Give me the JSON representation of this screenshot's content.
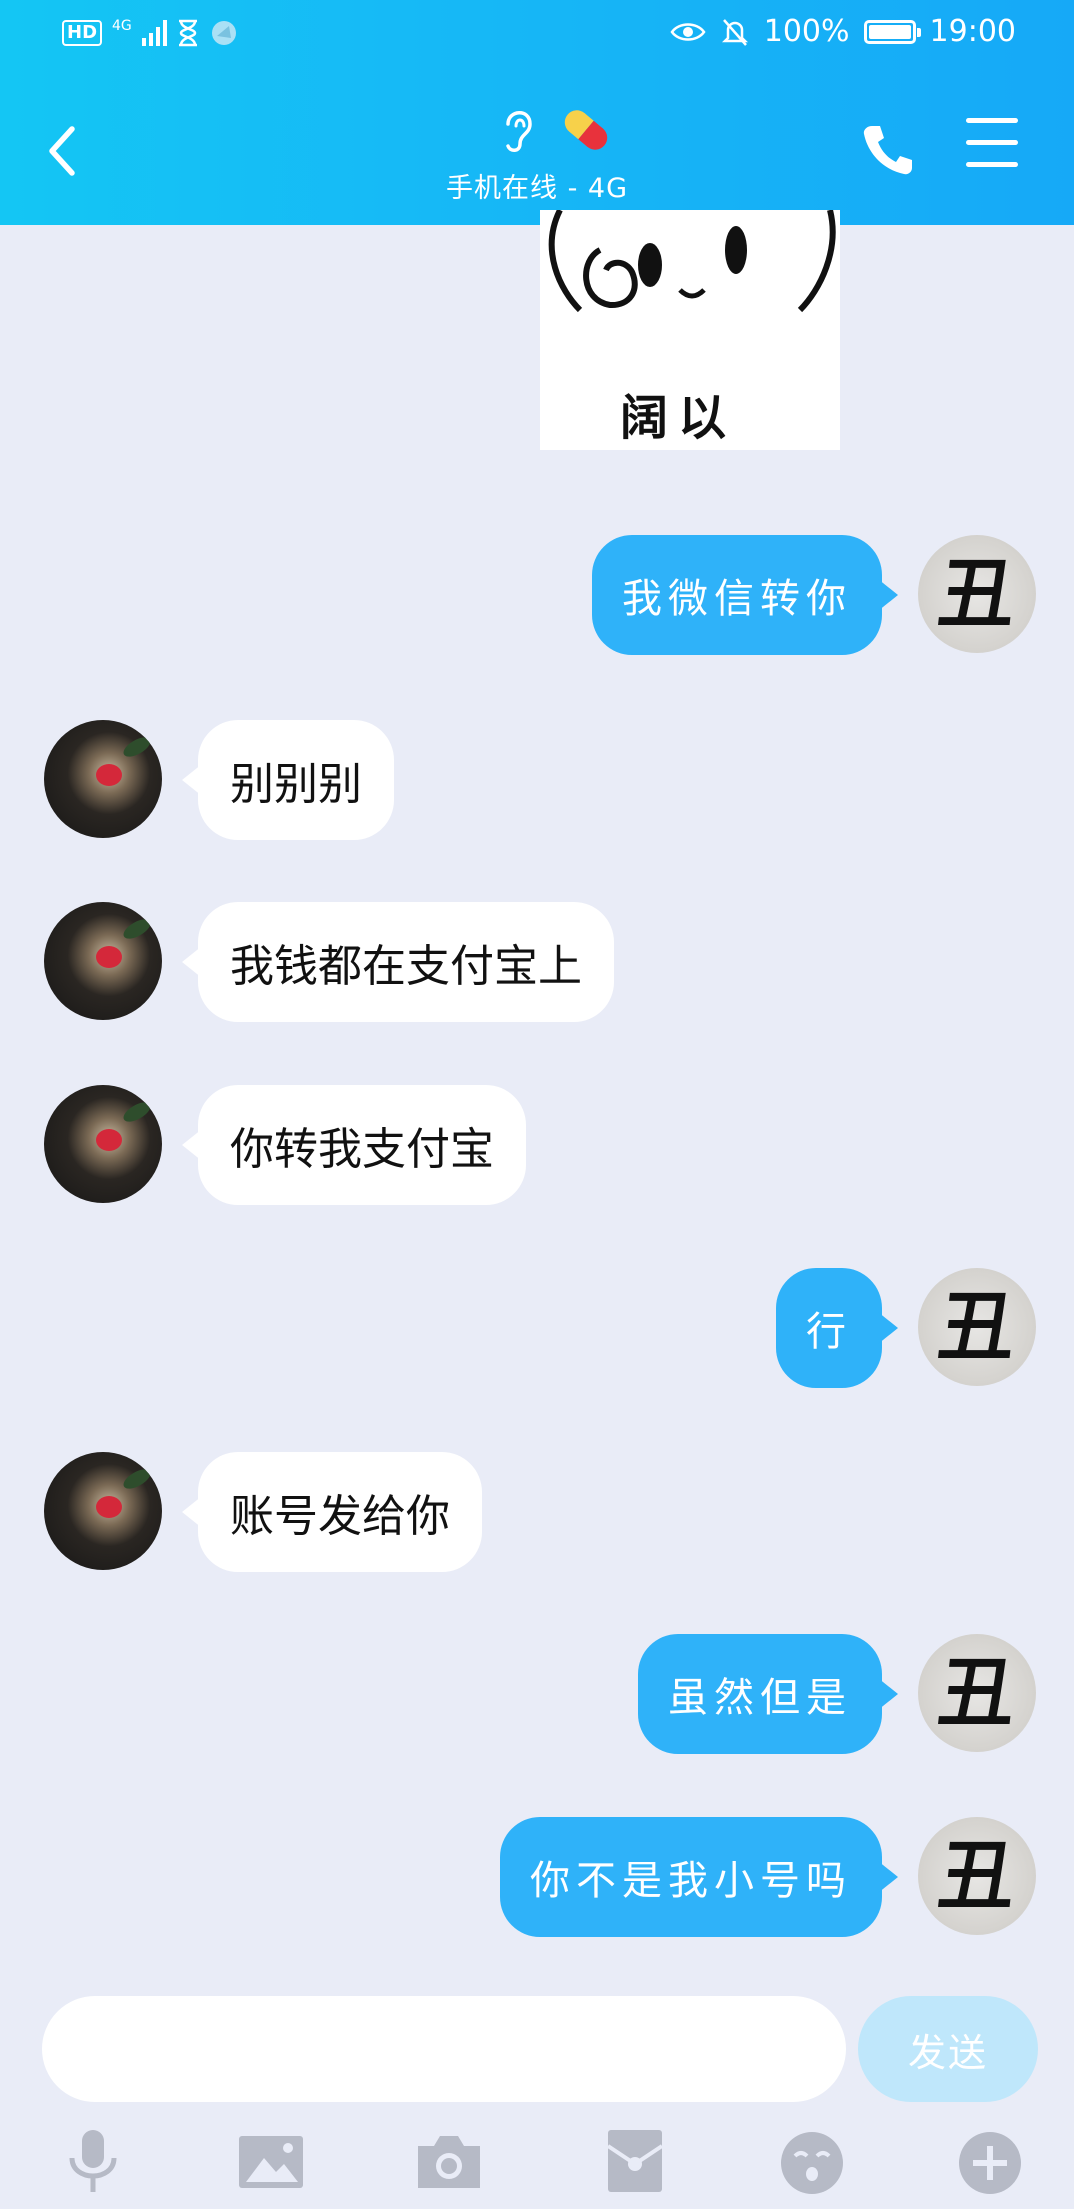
{
  "status_bar": {
    "network": "4G",
    "hd": "HD",
    "battery": "100%",
    "time": "19:00"
  },
  "header": {
    "subtitle": "手机在线 - 4G"
  },
  "sticker": {
    "caption": "阔以"
  },
  "messages": [
    {
      "from": "me",
      "text": "我微信转你"
    },
    {
      "from": "them",
      "text": "别别别"
    },
    {
      "from": "them",
      "text": "我钱都在支付宝上"
    },
    {
      "from": "them",
      "text": "你转我支付宝"
    },
    {
      "from": "me",
      "text": "行"
    },
    {
      "from": "them",
      "text": "账号发给你"
    },
    {
      "from": "me",
      "text": "虽然但是"
    },
    {
      "from": "me",
      "text": "你不是我小号吗"
    }
  ],
  "my_avatar_glyph": "丑",
  "input": {
    "placeholder": "",
    "send_label": "发送"
  },
  "toolbar_icons": [
    "microphone-icon",
    "image-icon",
    "camera-icon",
    "red-packet-icon",
    "emoji-icon",
    "plus-icon"
  ],
  "colors": {
    "header": "#16b9f6",
    "my_bubble": "#2fb2f9",
    "their_bubble": "#ffffff",
    "background": "#e9ecf7",
    "send_button": "#bfe7fb"
  }
}
